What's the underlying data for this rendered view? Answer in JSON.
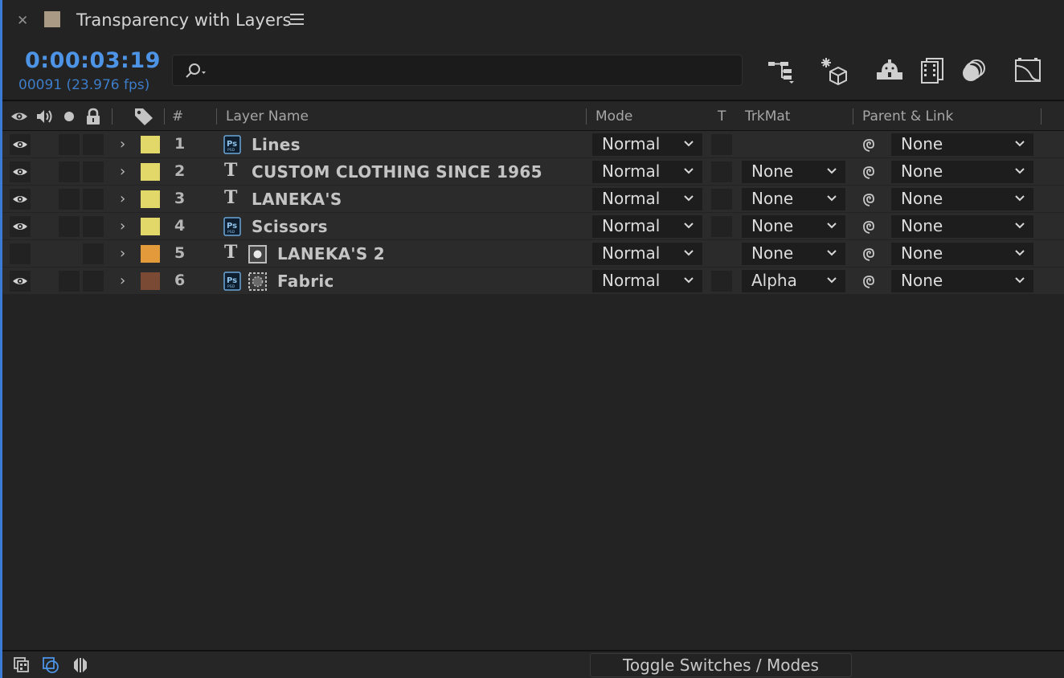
{
  "tab": {
    "title": "Transparency with Layers",
    "swatch_color": "#a89a84"
  },
  "time": {
    "timecode": "0:00:03:19",
    "frames": "00091 (23.976 fps)"
  },
  "search": {
    "value": "",
    "icon": "search-icon"
  },
  "toolbar": [
    {
      "name": "composition-flowchart-icon"
    },
    {
      "name": "draft-3d-icon"
    },
    {
      "name": "shy-layers-icon"
    },
    {
      "name": "frame-blending-icon"
    },
    {
      "name": "motion-blur-icon"
    },
    {
      "name": "graph-editor-icon"
    }
  ],
  "header": {
    "num": "#",
    "layer_name": "Layer Name",
    "mode": "Mode",
    "t": "T",
    "trkmat": "TrkMat",
    "parent": "Parent & Link"
  },
  "layers": [
    {
      "num": "1",
      "name": "Lines",
      "type": "ps",
      "sub": "",
      "visible": true,
      "label_color": "#e2d86a",
      "mode": "Normal",
      "trkmat": "",
      "parent": "None"
    },
    {
      "num": "2",
      "name": "CUSTOM CLOTHING  SINCE 1965",
      "type": "text",
      "sub": "",
      "visible": true,
      "label_color": "#e2d86a",
      "mode": "Normal",
      "trkmat": "None",
      "parent": "None"
    },
    {
      "num": "3",
      "name": "LANEKA'S",
      "type": "text",
      "sub": "",
      "visible": true,
      "label_color": "#e2d86a",
      "mode": "Normal",
      "trkmat": "None",
      "parent": "None"
    },
    {
      "num": "4",
      "name": "Scissors",
      "type": "ps",
      "sub": "",
      "visible": true,
      "label_color": "#e2d86a",
      "mode": "Normal",
      "trkmat": "None",
      "parent": "None"
    },
    {
      "num": "5",
      "name": "LANEKA'S 2",
      "type": "text",
      "sub": "matte-source",
      "visible": false,
      "label_color": "#e39a3b",
      "mode": "Normal",
      "trkmat": "None",
      "parent": "None"
    },
    {
      "num": "6",
      "name": "Fabric",
      "type": "ps",
      "sub": "matte-target",
      "visible": true,
      "label_color": "#7a4a35",
      "mode": "Normal",
      "trkmat": "Alpha",
      "parent": "None"
    }
  ],
  "footer": {
    "toggle_label": "Toggle Switches / Modes"
  }
}
